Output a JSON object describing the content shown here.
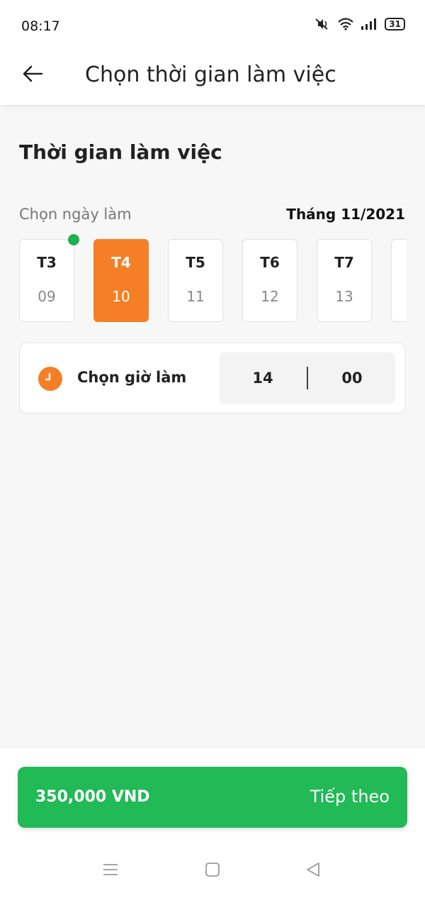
{
  "status_bar": {
    "time": "08:17",
    "battery": "31",
    "icons": [
      "mute-icon",
      "wifi-icon",
      "signal-icon",
      "battery-icon"
    ]
  },
  "header": {
    "back_icon": "arrow-left-icon",
    "title": "Chọn thời gian làm việc"
  },
  "section": {
    "title": "Thời gian làm việc",
    "date_label": "Chọn ngày làm",
    "month_label": "Tháng 11/2021"
  },
  "days": [
    {
      "weekday": "T3",
      "day": "09",
      "selected": false,
      "today": true
    },
    {
      "weekday": "T4",
      "day": "10",
      "selected": true,
      "today": false
    },
    {
      "weekday": "T5",
      "day": "11",
      "selected": false,
      "today": false
    },
    {
      "weekday": "T6",
      "day": "12",
      "selected": false,
      "today": false
    },
    {
      "weekday": "T7",
      "day": "13",
      "selected": false,
      "today": false
    }
  ],
  "time": {
    "label": "Chọn giờ làm",
    "hour": "14",
    "minute": "00",
    "icon": "clock-icon"
  },
  "footer": {
    "price": "350,000 VND",
    "next_label": "Tiếp theo"
  },
  "system_nav": [
    "menu-icon",
    "home-icon",
    "back-triangle-icon"
  ],
  "colors": {
    "accent": "#f57f27",
    "primary_button": "#22b957",
    "today_dot": "#22b04f"
  }
}
